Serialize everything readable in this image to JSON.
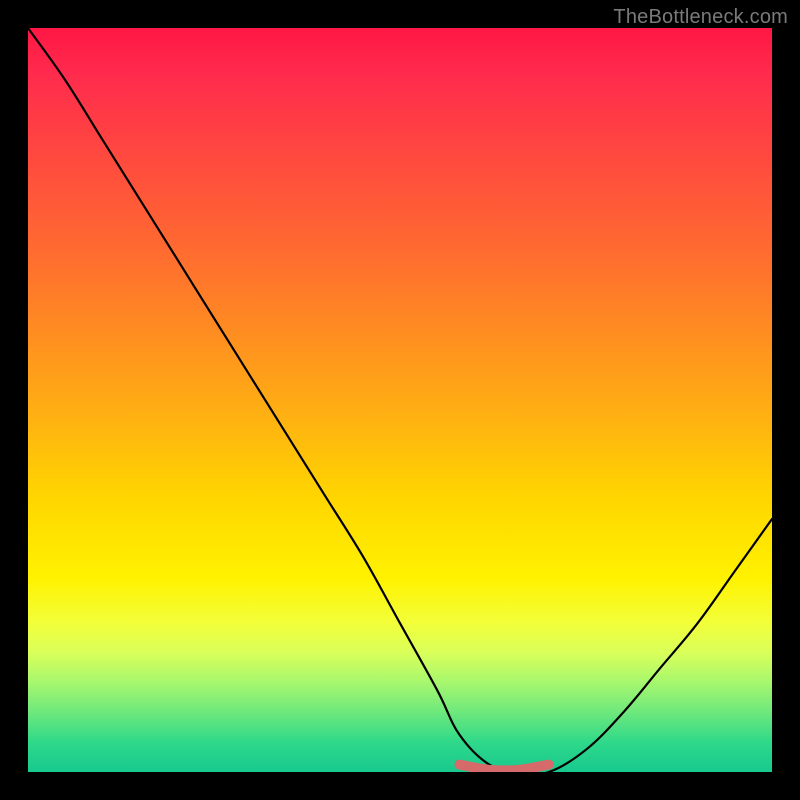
{
  "watermark": {
    "text": "TheBottleneck.com"
  },
  "chart_data": {
    "type": "line",
    "title": "",
    "xlabel": "",
    "ylabel": "",
    "xlim": [
      0,
      100
    ],
    "ylim": [
      0,
      100
    ],
    "grid": false,
    "series": [
      {
        "name": "bottleneck-curve",
        "color": "#000000",
        "x": [
          0,
          5,
          10,
          15,
          20,
          25,
          30,
          35,
          40,
          45,
          50,
          55,
          58,
          62,
          66,
          70,
          75,
          80,
          85,
          90,
          95,
          100
        ],
        "values": [
          100,
          93,
          85,
          77,
          69,
          61,
          53,
          45,
          37,
          29,
          20,
          11,
          5,
          1,
          0,
          0,
          3,
          8,
          14,
          20,
          27,
          34
        ]
      },
      {
        "name": "highlight-segment",
        "color": "#d66a6a",
        "x": [
          58,
          62,
          66,
          70
        ],
        "values": [
          1,
          0.3,
          0.3,
          1
        ]
      }
    ],
    "background_gradient": {
      "direction": "top-to-bottom",
      "stops": [
        {
          "pos": 0,
          "color": "#ff1744"
        },
        {
          "pos": 18,
          "color": "#ff4b3e"
        },
        {
          "pos": 40,
          "color": "#ff8a22"
        },
        {
          "pos": 63,
          "color": "#ffd500"
        },
        {
          "pos": 80,
          "color": "#f2ff3a"
        },
        {
          "pos": 92,
          "color": "#6de87c"
        },
        {
          "pos": 100,
          "color": "#17c98e"
        }
      ]
    }
  }
}
